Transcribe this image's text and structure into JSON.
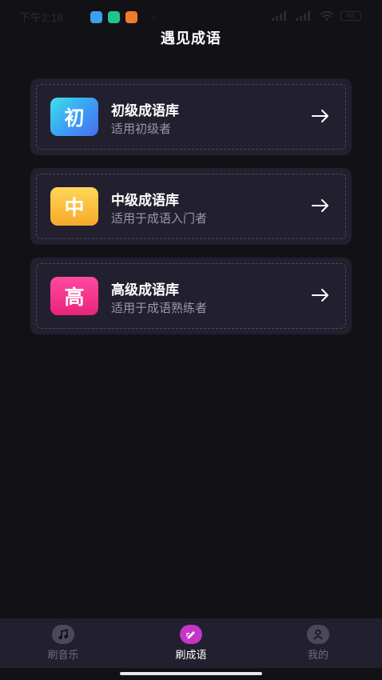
{
  "status_bar": {
    "time": "下午2:18",
    "more": "···",
    "battery": "66",
    "app_icon_colors": [
      "#3aa0f0",
      "#1fc58a",
      "#f07a2a"
    ]
  },
  "header": {
    "title": "遇见成语"
  },
  "cards": [
    {
      "badge": "初",
      "title": "初级成语库",
      "subtitle": "适用初级者"
    },
    {
      "badge": "中",
      "title": "中级成语库",
      "subtitle": "适用于成语入门者"
    },
    {
      "badge": "高",
      "title": "高级成语库",
      "subtitle": "适用于成语熟练者"
    }
  ],
  "tab_bar": {
    "tabs": [
      {
        "label": "刷音乐",
        "icon": "music-note-icon",
        "active": false
      },
      {
        "label": "刷成语",
        "icon": "pencil-icon",
        "active": true
      },
      {
        "label": "我的",
        "icon": "user-icon",
        "active": false
      }
    ],
    "active_color": "#c436c8",
    "inactive_color": "#4a4958"
  }
}
